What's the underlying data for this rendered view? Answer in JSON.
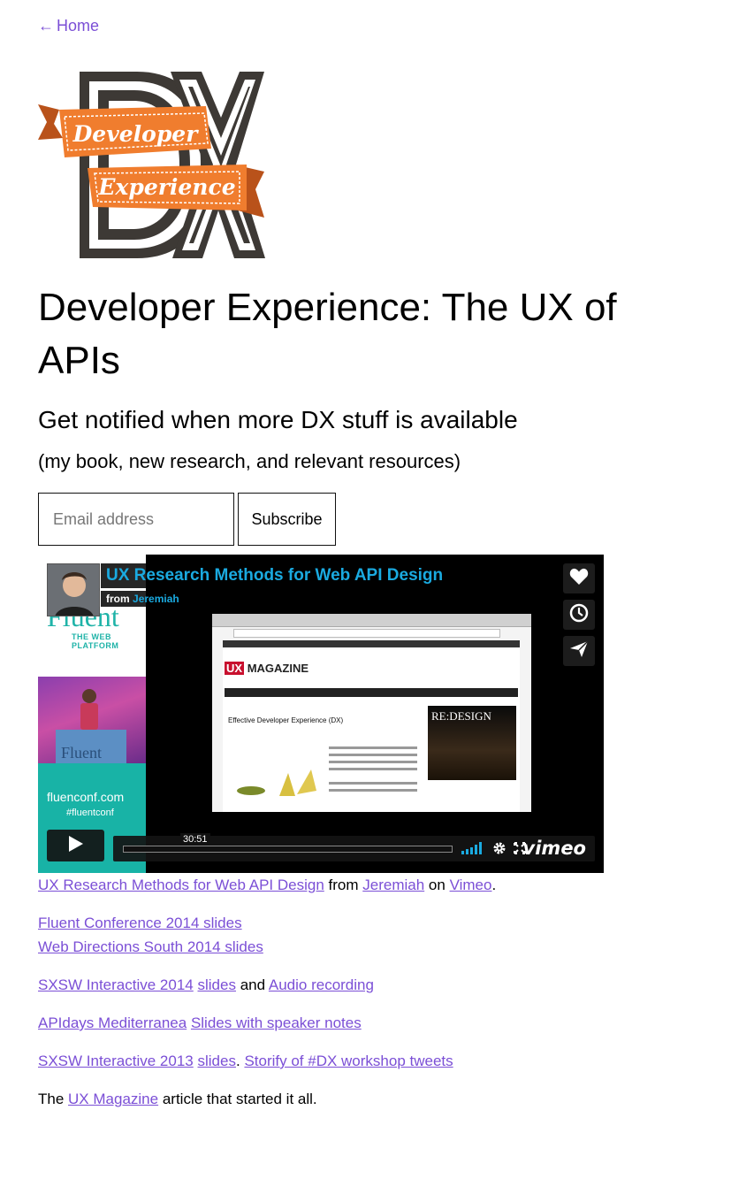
{
  "nav": {
    "back_arrow": "←",
    "home_label": "Home"
  },
  "logo": {
    "line1": "Developer",
    "line2": "Experience",
    "mark": "DX",
    "colors": {
      "dark": "#3d3935",
      "orange": "#f07d2e",
      "ribbon_dark": "#b9521a"
    }
  },
  "page_title": "Developer Experience: The UX of APIs",
  "signup": {
    "heading": "Get notified when more DX stuff is available",
    "subheading": "(my book, new research, and relevant resources)",
    "email_placeholder": "Email address",
    "subscribe_label": "Subscribe"
  },
  "video": {
    "title": "UX Research Methods for Web API Design",
    "byline_prefix": "from",
    "byline_author": "Jeremiah",
    "timecode": "30:51",
    "progress": 0.0,
    "brand": "vimeo",
    "side_buttons": [
      "heart-icon",
      "clock-icon",
      "send-icon"
    ],
    "thumb": {
      "fluent_word": "Fluent",
      "fluent_sub": "THE WEB PLATFORM",
      "conf_url": "fluenconf.com",
      "conf_tag": "#fluentconf",
      "magazine_logo_text": "MAGAZINE",
      "magazine_logo_mark": "UX",
      "article_title": "Effective Developer Experience (DX)",
      "redesign_text": "RE:DESIGN"
    }
  },
  "caption": {
    "video_link": "UX Research Methods for Web API Design",
    "from": "from",
    "author_link": "Jeremiah",
    "on": "on",
    "platform_link": "Vimeo",
    "end": "."
  },
  "links": {
    "fluent_2014": "Fluent Conference 2014 slides",
    "wds_2014": "Web Directions South 2014 slides",
    "sxsw_2014": "SXSW Interactive 2014",
    "sxsw_2014_slides": "slides",
    "and": "and",
    "audio_recording": "Audio recording",
    "apidays": "APIdays Mediterranea",
    "apidays_slides": "Slides with speaker notes",
    "sxsw_2013": "SXSW Interactive 2013",
    "sxsw_2013_slides": "slides",
    "period": ".",
    "storify": "Storify of #DX workshop tweets",
    "the": "The",
    "ux_magazine": "UX Magazine",
    "article_tail": "article that started it all."
  },
  "colors": {
    "link": "#7b4fd6",
    "vimeo_blue": "#1aaae0",
    "teal": "#18b3a6"
  }
}
